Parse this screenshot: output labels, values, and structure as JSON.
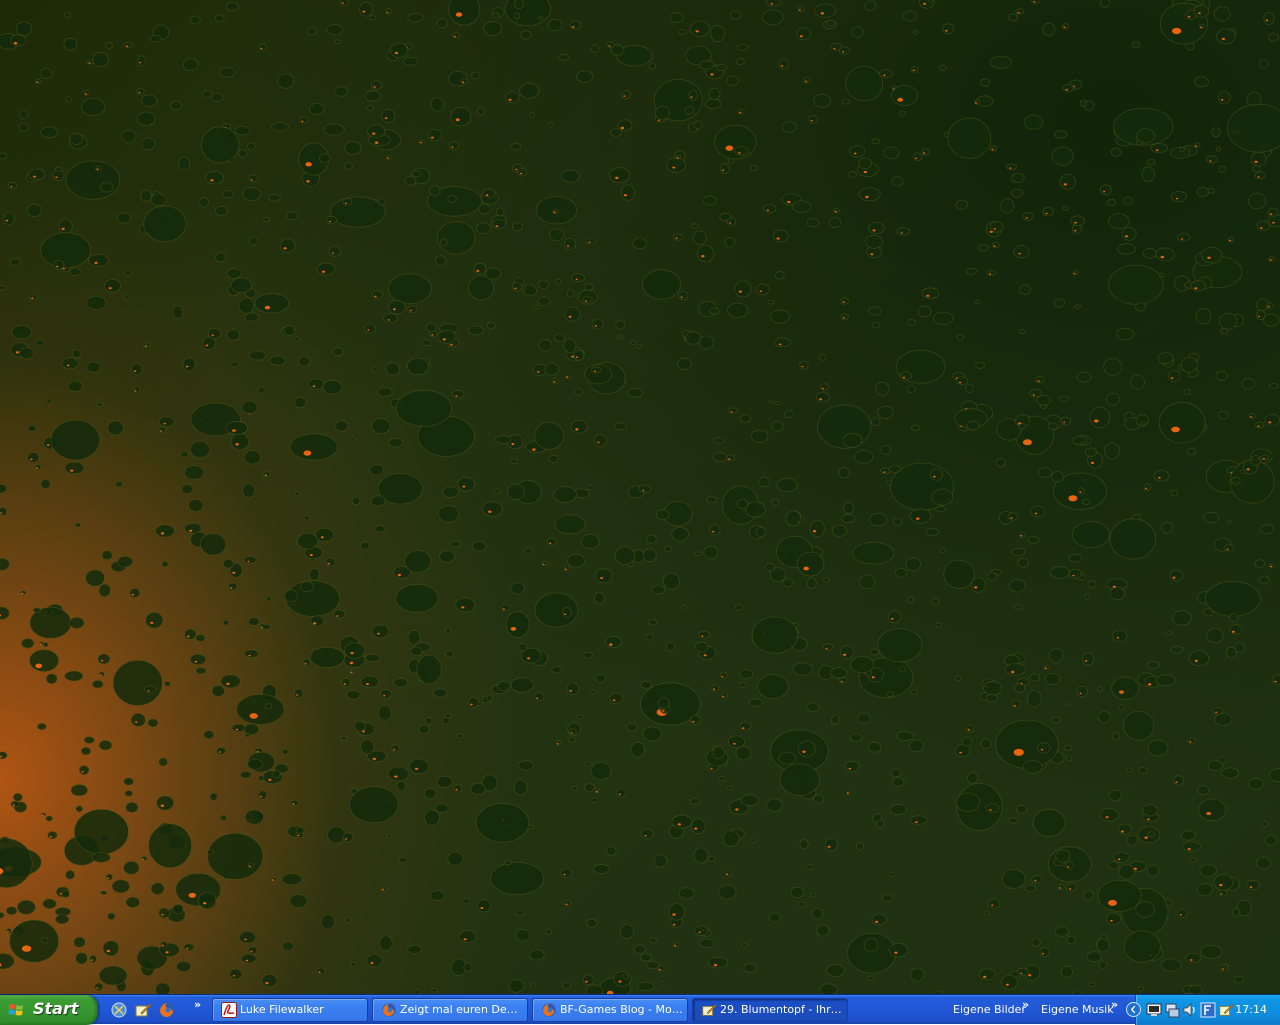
{
  "taskbar": {
    "start_label": "Start",
    "quick_launch": [
      {
        "icon": "browser-icon"
      },
      {
        "icon": "notepad-pen-icon"
      },
      {
        "icon": "firefox-icon"
      }
    ],
    "chevron": "»",
    "tasks": [
      {
        "label": "Luke Filewalker",
        "icon": "acrobat-icon",
        "active": false
      },
      {
        "label": "Zeigt mal euren Deskt...",
        "icon": "firefox-icon",
        "active": false
      },
      {
        "label": "BF-Games Blog - Mozil...",
        "icon": "firefox-icon",
        "active": false
      },
      {
        "label": "29. Blumentopf - Ihr ...",
        "icon": "notepad-pen-icon",
        "active": true
      }
    ],
    "toolbars": [
      {
        "label": "Eigene Bilder"
      },
      {
        "label": "Eigene Musik"
      }
    ],
    "tray": {
      "icons": [
        "monitor-icon",
        "network-icon",
        "speaker-icon",
        "font-icon",
        "notepad-pen-icon"
      ],
      "clock": "17:14"
    }
  },
  "colors": {
    "taskbar_blue": "#245edb",
    "start_green": "#3c9c33",
    "tray_blue": "#0f94e4",
    "wallpaper_dark": "#1f2f0e",
    "wallpaper_orange": "#c8561a"
  }
}
